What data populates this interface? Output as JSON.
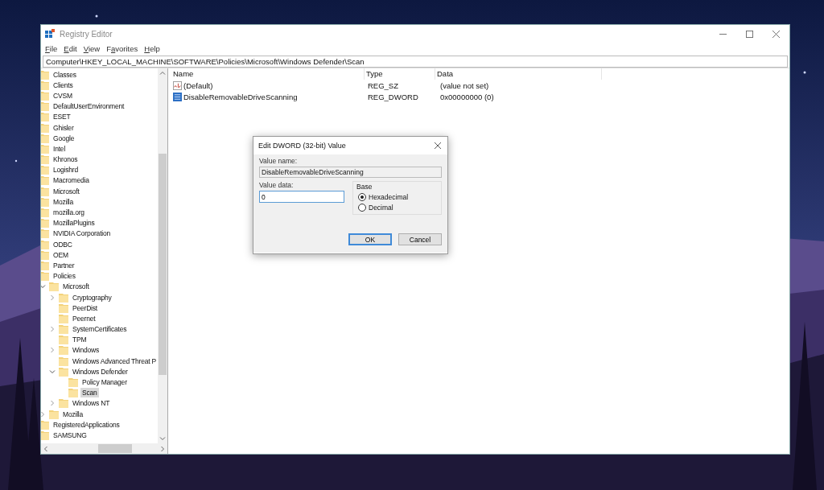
{
  "window": {
    "title": "Registry Editor"
  },
  "menu": [
    {
      "access_key": "F",
      "rest": "ile"
    },
    {
      "access_key": "E",
      "rest": "dit"
    },
    {
      "access_key": "V",
      "rest": "iew"
    },
    {
      "lead": "F",
      "access_key": "a",
      "rest": "vorites"
    },
    {
      "access_key": "H",
      "rest": "elp"
    }
  ],
  "address": "Computer\\HKEY_LOCAL_MACHINE\\SOFTWARE\\Policies\\Microsoft\\Windows Defender\\Scan",
  "tree": [
    {
      "label": "Classes",
      "selected": false
    },
    {
      "label": "Clients",
      "selected": false
    },
    {
      "label": "CVSM",
      "selected": false
    },
    {
      "label": "DefaultUserEnvironment",
      "selected": false
    },
    {
      "label": "ESET",
      "selected": false
    },
    {
      "label": "Ghisler",
      "selected": false
    },
    {
      "label": "Google",
      "selected": false
    },
    {
      "label": "Intel",
      "selected": false
    },
    {
      "label": "Khronos",
      "selected": false
    },
    {
      "label": "Logishrd",
      "selected": false
    },
    {
      "label": "Macromedia",
      "selected": false
    },
    {
      "label": "Microsoft",
      "selected": false
    },
    {
      "label": "Mozilla",
      "selected": false
    },
    {
      "label": "mozilla.org",
      "selected": false
    },
    {
      "label": "MozillaPlugins",
      "selected": false
    },
    {
      "label": "NVIDIA Corporation",
      "selected": false
    },
    {
      "label": "ODBC",
      "selected": false
    },
    {
      "label": "OEM",
      "selected": false
    },
    {
      "label": "Partner",
      "selected": false
    },
    {
      "label": "Policies",
      "selected": false,
      "children": [
        {
          "label": "Microsoft",
          "selected": false,
          "expanded": true,
          "children": [
            {
              "label": "Cryptography",
              "selected": false,
              "expanded": false
            },
            {
              "label": "PeerDist",
              "selected": false
            },
            {
              "label": "Peernet",
              "selected": false
            },
            {
              "label": "SystemCertificates",
              "selected": false,
              "expanded": false
            },
            {
              "label": "TPM",
              "selected": false
            },
            {
              "label": "Windows",
              "selected": false,
              "expanded": false
            },
            {
              "label": "Windows Advanced Threat P",
              "selected": false
            },
            {
              "label": "Windows Defender",
              "selected": false,
              "expanded": true,
              "children": [
                {
                  "label": "Policy Manager",
                  "selected": false
                },
                {
                  "label": "Scan",
                  "selected": true
                }
              ]
            },
            {
              "label": "Windows NT",
              "selected": false,
              "expanded": false
            }
          ]
        },
        {
          "label": "Mozilla",
          "selected": false,
          "expanded": false
        }
      ]
    },
    {
      "label": "RegisteredApplications",
      "selected": false
    },
    {
      "label": "SAMSUNG",
      "selected": false
    }
  ],
  "columns": [
    "Name",
    "Type",
    "Data"
  ],
  "values": [
    {
      "kind": "string",
      "name": "(Default)",
      "type": "REG_SZ",
      "data": "(value not set)",
      "selected": false
    },
    {
      "kind": "dword",
      "name": "DisableRemovableDriveScanning",
      "type": "REG_DWORD",
      "data": "0x00000000 (0)",
      "selected": false
    }
  ],
  "dialog": {
    "title": "Edit DWORD (32-bit) Value",
    "value_name_label": "Value name:",
    "value_name": "DisableRemovableDriveScanning",
    "value_data_label": "Value data:",
    "value_data": "0",
    "base_label": "Base",
    "bases": [
      {
        "label": "Hexadecimal",
        "selected": true
      },
      {
        "label": "Decimal",
        "selected": false
      }
    ],
    "buttons": [
      {
        "label": "OK",
        "default": true
      },
      {
        "label": "Cancel",
        "default": false
      }
    ]
  }
}
